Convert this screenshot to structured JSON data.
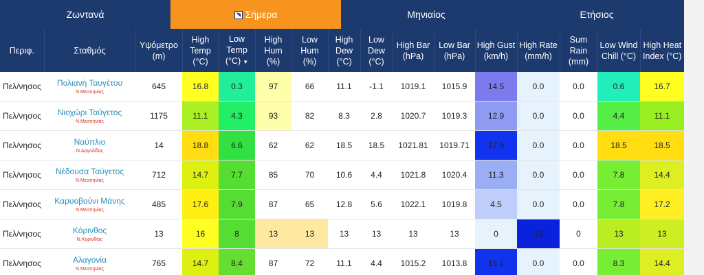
{
  "tabs": [
    {
      "label": "Ζωντανά",
      "active": false
    },
    {
      "label": "Σήμερα",
      "active": true
    },
    {
      "label": "Μηνιαίος",
      "active": false
    },
    {
      "label": "Ετήσιος",
      "active": false
    }
  ],
  "columns": [
    {
      "key": "region",
      "label": "Περιφ."
    },
    {
      "key": "station",
      "label": "Σταθμός"
    },
    {
      "key": "altitude",
      "label": "Υψόμετρο (m)"
    },
    {
      "key": "high_temp",
      "label": "High Temp (°C)"
    },
    {
      "key": "low_temp",
      "label": "Low Temp (°C)",
      "sort_indicator": "▼"
    },
    {
      "key": "high_hum",
      "label": "High Hum (%)"
    },
    {
      "key": "low_hum",
      "label": "Low Hum (%)"
    },
    {
      "key": "high_dew",
      "label": "High Dew (°C)"
    },
    {
      "key": "low_dew",
      "label": "Low Dew (°C)"
    },
    {
      "key": "high_bar",
      "label": "High Bar (hPa)"
    },
    {
      "key": "low_bar",
      "label": "Low Bar (hPa)"
    },
    {
      "key": "high_gust",
      "label": "High Gust (km/h)"
    },
    {
      "key": "high_rate",
      "label": "High Rate (mm/h)"
    },
    {
      "key": "sum_rain",
      "label": "Sum Rain (mm)"
    },
    {
      "key": "low_wind_chill",
      "label": "Low Wind Chill (°C)"
    },
    {
      "key": "high_heat_index",
      "label": "High Heat Index (°C)"
    }
  ],
  "rows": [
    {
      "region": "Πελ/νησος",
      "station": "Πολιανή Ταυγέτου",
      "prefecture": "Ν.Μεσσηνίας",
      "altitude": "645",
      "high_temp": {
        "v": "16.8",
        "bg": "#ffff22"
      },
      "low_temp": {
        "v": "0.3",
        "bg": "#22ee99"
      },
      "high_hum": {
        "v": "97",
        "bg": "#ffffaa"
      },
      "low_hum": {
        "v": "66",
        "bg": ""
      },
      "high_dew": "11.1",
      "low_dew": "-1.1",
      "high_bar": "1019.1",
      "low_bar": "1015.9",
      "high_gust": {
        "v": "14.5",
        "bg": "#7b7bef"
      },
      "high_rate": "0.0",
      "sum_rain": "0.0",
      "low_wind_chill": {
        "v": "0.6",
        "bg": "#22eebb"
      },
      "high_heat_index": {
        "v": "16.7",
        "bg": "#ffff22"
      }
    },
    {
      "region": "Πελ/νησος",
      "station": "Νιοχώρι Ταύγετος",
      "prefecture": "Ν.Μεσσηνίας",
      "altitude": "1175",
      "high_temp": {
        "v": "11.1",
        "bg": "#aaf022"
      },
      "low_temp": {
        "v": "4.3",
        "bg": "#22ee66"
      },
      "high_hum": {
        "v": "93",
        "bg": "#ffffaa"
      },
      "low_hum": {
        "v": "82",
        "bg": ""
      },
      "high_dew": "8.3",
      "low_dew": "2.8",
      "high_bar": "1020.7",
      "low_bar": "1019.3",
      "high_gust": {
        "v": "12.9",
        "bg": "#8f9af2"
      },
      "high_rate": "0.0",
      "sum_rain": "0.0",
      "low_wind_chill": {
        "v": "4.4",
        "bg": "#55ee44"
      },
      "high_heat_index": {
        "v": "11.1",
        "bg": "#99ee22"
      }
    },
    {
      "region": "Πελ/νησος",
      "station": "Ναύπλιο",
      "prefecture": "Ν.Αργολίδας",
      "altitude": "14",
      "high_temp": {
        "v": "18.8",
        "bg": "#ffdd11"
      },
      "low_temp": {
        "v": "6.6",
        "bg": "#33e044"
      },
      "high_hum": {
        "v": "62",
        "bg": ""
      },
      "low_hum": {
        "v": "62",
        "bg": ""
      },
      "high_dew": "18.5",
      "low_dew": "18.5",
      "high_bar": "1021.81",
      "low_bar": "1019.71",
      "high_gust": {
        "v": "17.9",
        "bg": "#1133ee"
      },
      "high_rate": "0.0",
      "sum_rain": "0.0",
      "low_wind_chill": {
        "v": "18.5",
        "bg": "#ffdd11"
      },
      "high_heat_index": {
        "v": "18.5",
        "bg": "#ffdd11"
      }
    },
    {
      "region": "Πελ/νησος",
      "station": "Νέδουσα Ταύγετος",
      "prefecture": "Ν.Μεσσηνίας",
      "altitude": "712",
      "high_temp": {
        "v": "14.7",
        "bg": "#ddf011"
      },
      "low_temp": {
        "v": "7.7",
        "bg": "#55dd33"
      },
      "high_hum": {
        "v": "85",
        "bg": ""
      },
      "low_hum": {
        "v": "70",
        "bg": ""
      },
      "high_dew": "10.6",
      "low_dew": "4.4",
      "high_bar": "1021.8",
      "low_bar": "1020.4",
      "high_gust": {
        "v": "11.3",
        "bg": "#9aaef6"
      },
      "high_rate": "0.0",
      "sum_rain": "0.0",
      "low_wind_chill": {
        "v": "7.8",
        "bg": "#77ee33"
      },
      "high_heat_index": {
        "v": "14.4",
        "bg": "#ddee22"
      }
    },
    {
      "region": "Πελ/νησος",
      "station": "Καρυοβούνι Μάνης",
      "prefecture": "Ν.Μεσσηνίας",
      "altitude": "485",
      "high_temp": {
        "v": "17.6",
        "bg": "#ffee11"
      },
      "low_temp": {
        "v": "7.9",
        "bg": "#55dd33"
      },
      "high_hum": {
        "v": "87",
        "bg": ""
      },
      "low_hum": {
        "v": "65",
        "bg": ""
      },
      "high_dew": "12.8",
      "low_dew": "5.6",
      "high_bar": "1022.1",
      "low_bar": "1019.8",
      "high_gust": {
        "v": "4.5",
        "bg": "#bfcdfa"
      },
      "high_rate": "0.0",
      "sum_rain": "0.0",
      "low_wind_chill": {
        "v": "7.8",
        "bg": "#77ee33"
      },
      "high_heat_index": {
        "v": "17.2",
        "bg": "#ffee22"
      }
    },
    {
      "region": "Πελ/νησος",
      "station": "Κόρινθος",
      "prefecture": "Ν.Κορινθίας",
      "altitude": "13",
      "high_temp": {
        "v": "16",
        "bg": "#ffff22"
      },
      "low_temp": {
        "v": "8",
        "bg": "#55dd33"
      },
      "high_hum": {
        "v": "13",
        "bg": "#ffe9a0"
      },
      "low_hum": {
        "v": "13",
        "bg": "#ffe9a0"
      },
      "high_dew": "13",
      "low_dew": "13",
      "high_bar": "13",
      "low_bar": "13",
      "high_gust": {
        "v": "0",
        "bg": "#e6f2fc"
      },
      "high_rate": {
        "v": "13",
        "bg": "#0b22dd"
      },
      "sum_rain": "0",
      "low_wind_chill": {
        "v": "13",
        "bg": "#bbee22"
      },
      "high_heat_index": {
        "v": "13",
        "bg": "#ccee22"
      }
    },
    {
      "region": "Πελ/νησος",
      "station": "Αλαγονία",
      "prefecture": "Ν.Μεσσηνίας",
      "altitude": "765",
      "high_temp": {
        "v": "14.7",
        "bg": "#ddf011"
      },
      "low_temp": {
        "v": "8.4",
        "bg": "#66dd33"
      },
      "high_hum": {
        "v": "87",
        "bg": ""
      },
      "low_hum": {
        "v": "72",
        "bg": ""
      },
      "high_dew": "11.1",
      "low_dew": "4.4",
      "high_bar": "1015.2",
      "low_bar": "1013.8",
      "high_gust": {
        "v": "16.1",
        "bg": "#1133ee"
      },
      "high_rate": "0.0",
      "sum_rain": "0.0",
      "low_wind_chill": {
        "v": "8.3",
        "bg": "#77ee33"
      },
      "high_heat_index": {
        "v": "14.4",
        "bg": "#ddee22"
      }
    }
  ],
  "colors": {
    "header_bg": "#1c3a6e",
    "active_tab_bg": "#f7941d",
    "station_link": "#2a8fbd",
    "prefecture_text": "#d22e1e",
    "rate_default_bg": "#e6f2fc"
  },
  "icons": {
    "active_tab": "calendar-page-icon"
  }
}
